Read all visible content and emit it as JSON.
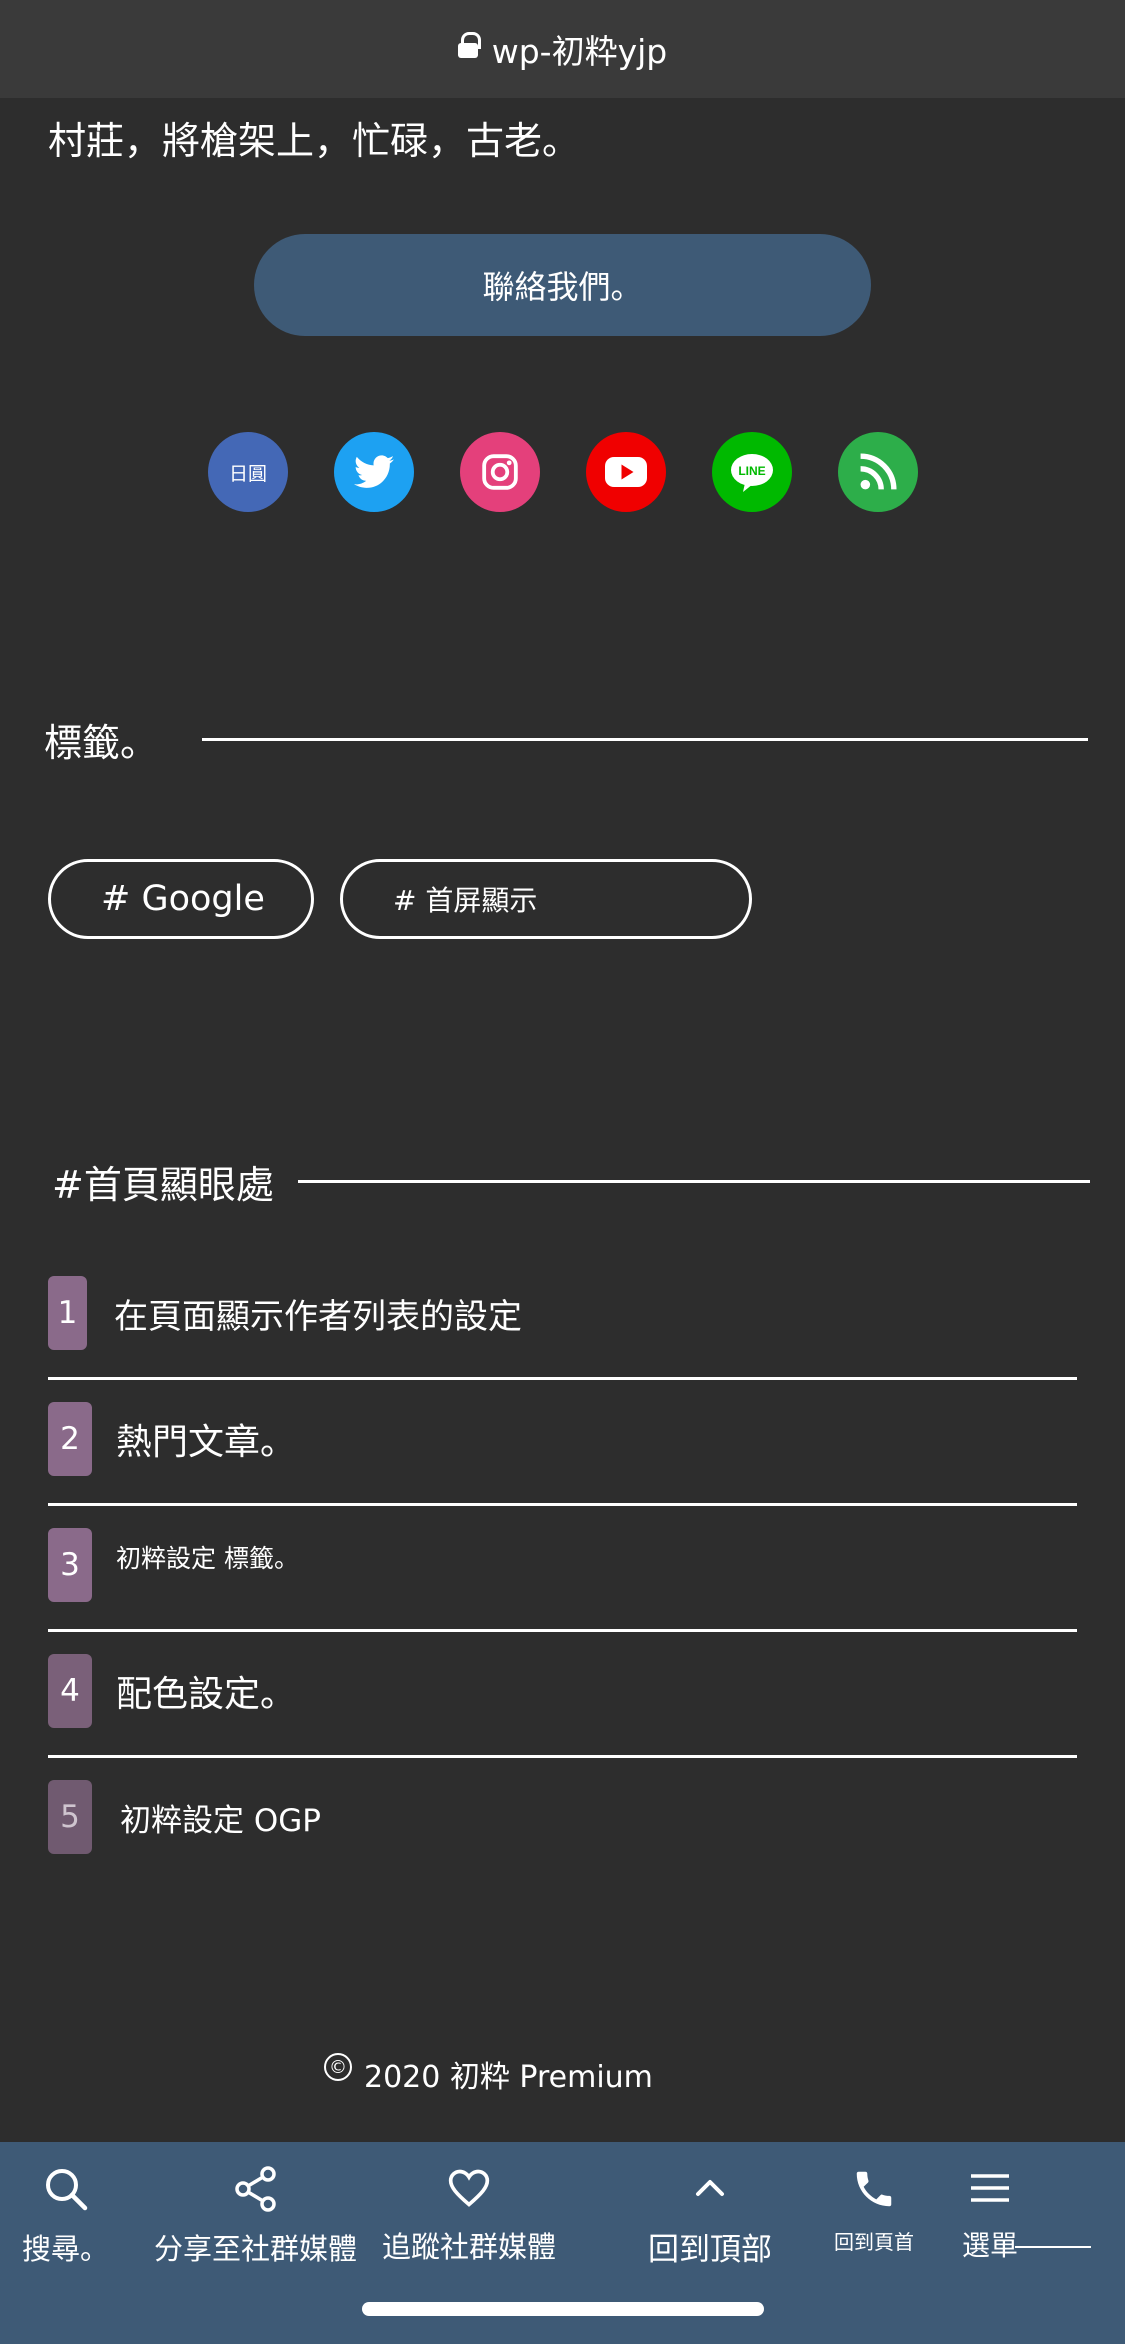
{
  "browser": {
    "site_title": "wp-初粋yjp"
  },
  "intro": {
    "text": "村莊，將槍架上，忙碌，古老。"
  },
  "contact": {
    "label": "聯絡我們。"
  },
  "social": {
    "hatena_label": "日圓",
    "line_label": "LINE",
    "icons": [
      "hatena-icon",
      "twitter-icon",
      "instagram-icon",
      "youtube-icon",
      "line-icon",
      "rss-icon"
    ],
    "colors": {
      "hatena": "#4468b6",
      "twitter": "#1da1f2",
      "instagram": "#e4407b",
      "youtube": "#f00000",
      "line": "#00b900",
      "rss": "#2dae4a"
    }
  },
  "tags_section": {
    "heading": "標籤。",
    "tags": [
      "# Google",
      "# 首屏顯示"
    ]
  },
  "ranking_section": {
    "heading": "#首頁顯眼處",
    "items": [
      {
        "num": "1",
        "title": "在頁面顯示作者列表的設定"
      },
      {
        "num": "2",
        "title": "熱門文章。"
      },
      {
        "num": "3",
        "title": "初粹設定 標籤。"
      },
      {
        "num": "4",
        "title": "配色設定。"
      },
      {
        "num": "5",
        "title": "初粹設定 OGP"
      }
    ]
  },
  "footer": {
    "copyright_symbol": "©",
    "copyright": "2020 初粋 Premium"
  },
  "bottom_nav": {
    "search": "搜尋。",
    "share": "分享至社群媒體",
    "follow": "追蹤社群媒體",
    "top": "回到頂部",
    "home": "回到頁首",
    "menu": "選單"
  },
  "theme": {
    "background": "#2d2d2d",
    "nav_bg": "#3e5a76",
    "rank_badge": "#8a6a8a"
  }
}
